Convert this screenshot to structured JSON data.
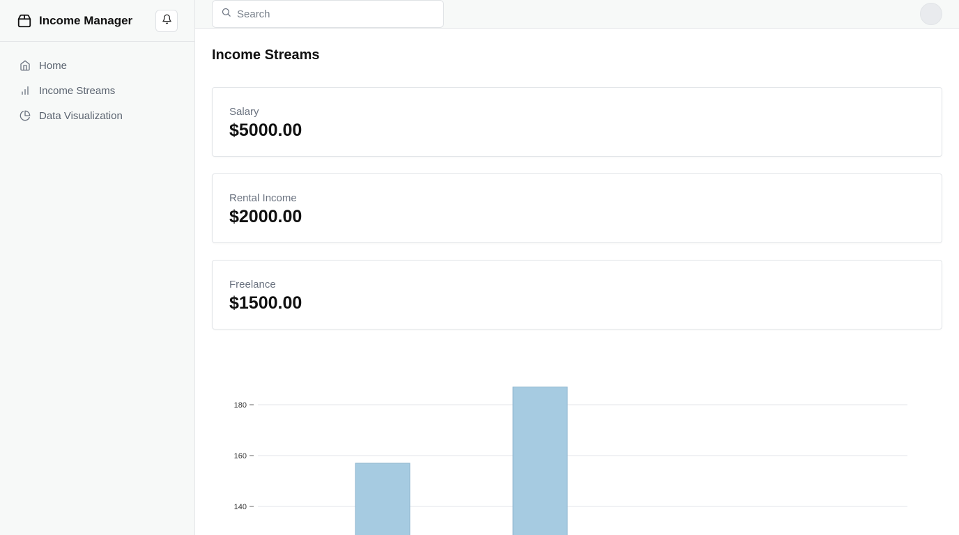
{
  "app": {
    "name": "Income Manager"
  },
  "sidebar": {
    "items": [
      {
        "label": "Home",
        "icon": "home-icon"
      },
      {
        "label": "Income Streams",
        "icon": "bar-chart-icon"
      },
      {
        "label": "Data Visualization",
        "icon": "pie-chart-icon"
      }
    ]
  },
  "topbar": {
    "search_placeholder": "Search"
  },
  "page": {
    "title": "Income Streams"
  },
  "cards": [
    {
      "label": "Salary",
      "value": "$5000.00"
    },
    {
      "label": "Rental Income",
      "value": "$2000.00"
    },
    {
      "label": "Freelance",
      "value": "$1500.00"
    }
  ],
  "colors": {
    "bar_fill": "#a6cbe1",
    "bar_stroke": "#8fb6cf",
    "grid": "#e3e6e9"
  },
  "chart_data": {
    "type": "bar",
    "yticks": [
      140,
      160,
      180
    ],
    "ylim_visible": [
      133,
      193
    ],
    "values": [
      157,
      187
    ],
    "grid": true
  }
}
